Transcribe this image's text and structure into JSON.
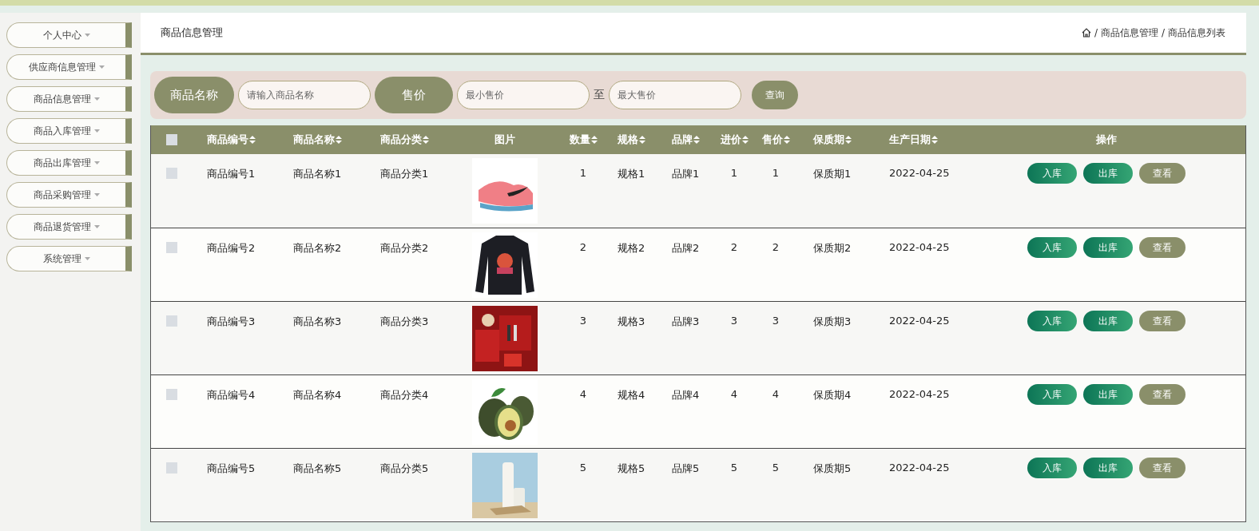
{
  "sidebar": {
    "items": [
      {
        "label": "个人中心"
      },
      {
        "label": "供应商信息管理"
      },
      {
        "label": "商品信息管理"
      },
      {
        "label": "商品入库管理"
      },
      {
        "label": "商品出库管理"
      },
      {
        "label": "商品采购管理"
      },
      {
        "label": "商品退货管理"
      },
      {
        "label": "系统管理"
      }
    ]
  },
  "header": {
    "title": "商品信息管理",
    "breadcrumb": [
      {
        "separator": "/",
        "label": "商品信息管理"
      },
      {
        "separator": "/",
        "label": "商品信息列表"
      }
    ]
  },
  "search": {
    "name_label": "商品名称",
    "name_placeholder": "请输入商品名称",
    "price_label": "售价",
    "min_placeholder": "最小售价",
    "separator": "至",
    "max_placeholder": "最大售价",
    "button": "查询"
  },
  "table": {
    "select_all": {
      "checked": false
    },
    "columns": [
      {
        "label": "商品编号",
        "sortable": true
      },
      {
        "label": "商品名称",
        "sortable": true
      },
      {
        "label": "商品分类",
        "sortable": true
      },
      {
        "label": "图片",
        "sortable": false
      },
      {
        "label": "数量",
        "sortable": true
      },
      {
        "label": "规格",
        "sortable": true
      },
      {
        "label": "品牌",
        "sortable": true
      },
      {
        "label": "进价",
        "sortable": true
      },
      {
        "label": "售价",
        "sortable": true
      },
      {
        "label": "保质期",
        "sortable": true
      },
      {
        "label": "生产日期",
        "sortable": true
      },
      {
        "label": "操作",
        "sortable": false
      }
    ],
    "rows": [
      {
        "checked": false,
        "cells": [
          "商品编号1",
          "商品名称1",
          "商品分类1",
          {
            "kind": "picture"
          },
          "1",
          "规格1",
          "品牌1",
          "1",
          "1",
          "保质期1",
          "2022-04-25"
        ],
        "actions": [
          "入库",
          "出库",
          "查看"
        ]
      },
      {
        "checked": false,
        "cells": [
          "商品编号2",
          "商品名称2",
          "商品分类2",
          {
            "kind": "picture"
          },
          "2",
          "规格2",
          "品牌2",
          "2",
          "2",
          "保质期2",
          "2022-04-25"
        ],
        "actions": [
          "入库",
          "出库",
          "查看"
        ]
      },
      {
        "checked": false,
        "cells": [
          "商品编号3",
          "商品名称3",
          "商品分类3",
          {
            "kind": "picture"
          },
          "3",
          "规格3",
          "品牌3",
          "3",
          "3",
          "保质期3",
          "2022-04-25"
        ],
        "actions": [
          "入库",
          "出库",
          "查看"
        ]
      },
      {
        "checked": false,
        "cells": [
          "商品编号4",
          "商品名称4",
          "商品分类4",
          {
            "kind": "picture"
          },
          "4",
          "规格4",
          "品牌4",
          "4",
          "4",
          "保质期4",
          "2022-04-25"
        ],
        "actions": [
          "入库",
          "出库",
          "查看"
        ]
      },
      {
        "checked": false,
        "cells": [
          "商品编号5",
          "商品名称5",
          "商品分类5",
          {
            "kind": "picture"
          },
          "5",
          "规格5",
          "品牌5",
          "5",
          "5",
          "保质期5",
          "2022-04-25"
        ],
        "actions": [
          "入库",
          "出库",
          "查看"
        ]
      }
    ]
  }
}
